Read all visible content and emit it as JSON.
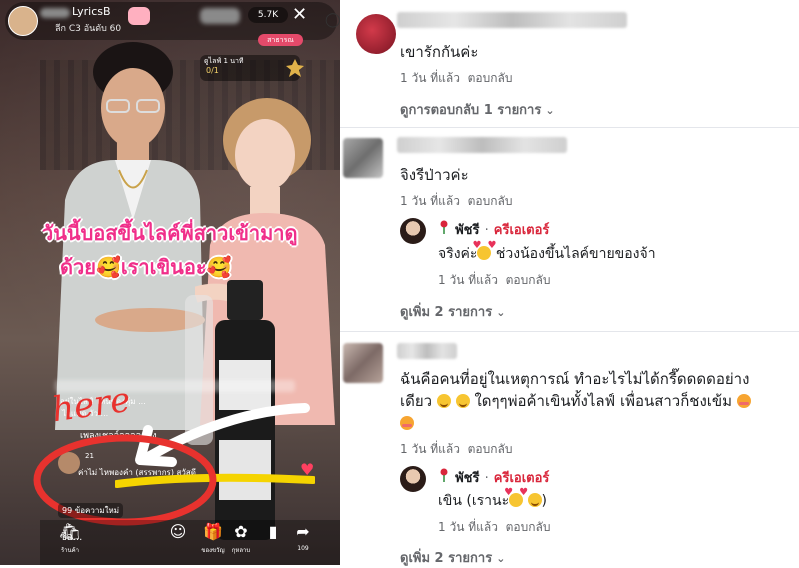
{
  "live": {
    "channel_name": "LyricsB",
    "viewer_count": "5.7K",
    "sub_label": "ลีก C3 อันดับ 60",
    "quest_title": "ดูไลฟ์ 1 นาที",
    "quest_progress": "0/1",
    "pink_tag": "สาธารณ",
    "caption_line1": "วันนี้บอสขึ้นไลค์พี่สาวเข้ามาดู",
    "caption_line2": "ด้วย🥰เราเขินอะ🥰",
    "annotation_word": "here",
    "new_messages_label": "99 ข้อความใหม่",
    "buy_label": "ซื้อ...",
    "bottom_bar": [
      {
        "icon": "shop-icon",
        "label": "ร้านค้า"
      },
      {
        "icon": "smile-icon",
        "label": ""
      },
      {
        "icon": "gift-icon",
        "label": "ของขวัญ"
      },
      {
        "icon": "rose-icon",
        "label": "กุหลาบ"
      },
      {
        "icon": "share-icon",
        "label": "109"
      }
    ],
    "chat_lines": [
      "อยู่ในไลฟ์ ไหนของคุ้ม ...",
      "ไอแพด วัว ...",
      "เพลงเชลล์ลลลลลลง",
      "ค่าไม่ ไหพองคำ (สรรพากร) สวัสดี"
    ],
    "comment_count_badge": "21",
    "colors": {
      "caption": "#f02f8a",
      "annotation": "#e8322e",
      "highlight": "#f5d400"
    }
  },
  "comments": [
    {
      "text": "เขารักกันค่ะ",
      "time": "1 วัน ที่แล้ว",
      "reply_label": "ตอบกลับ",
      "more_replies": "ดูการตอบกลับ 1 รายการ",
      "avatar_color": "#b52a3a"
    },
    {
      "text": "จิงรีป่าวค่ะ",
      "time": "1 วัน ที่แล้ว",
      "reply_label": "ตอบกลับ",
      "avatar_color": "#8c8c8c",
      "reply": {
        "name": "พัชรี",
        "badge": "ครีเอเตอร์",
        "text": "จริงค่ะ",
        "text_after": "ช่วงน้องขึ้นไลค์ขายของจ้า",
        "time": "1 วัน ที่แล้ว",
        "reply_label": "ตอบกลับ"
      },
      "more_replies": "ดูเพิ่ม 2 รายการ"
    },
    {
      "text_line1": "ฉันคือคนที่อยู่ในเหตุการณ์ ทำอะไรไม่ได้กรี๊ดดดดอย่าง",
      "text_line2_a": "เดียว",
      "text_line2_b": "ใดๆๆพ่อค้าเขินทั้งไลฟ์ เพื่อนสาวก็ชงเข้ม",
      "time": "1 วัน ที่แล้ว",
      "reply_label": "ตอบกลับ",
      "avatar_color": "#9a8a85",
      "reply": {
        "name": "พัชรี",
        "badge": "ครีเอเตอร์",
        "text": "เขิน (เรานะ",
        "text_after": ")",
        "time": "1 วัน ที่แล้ว",
        "reply_label": "ตอบกลับ"
      },
      "more_replies": "ดูเพิ่ม 2 รายการ"
    }
  ]
}
